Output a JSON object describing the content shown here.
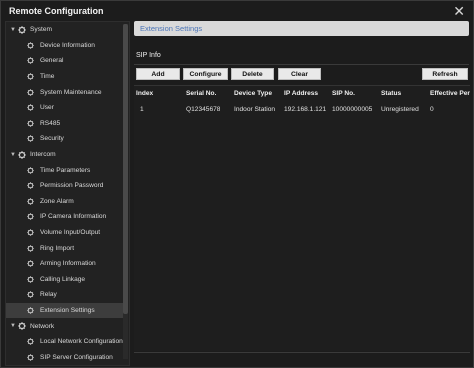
{
  "window": {
    "title": "Remote Configuration",
    "close_glyph": "✕"
  },
  "tree": {
    "groups": [
      {
        "label": "System",
        "items": [
          "Device Information",
          "General",
          "Time",
          "System Maintenance",
          "User",
          "RS485",
          "Security"
        ]
      },
      {
        "label": "Intercom",
        "items": [
          "Time Parameters",
          "Permission Password",
          "Zone Alarm",
          "IP Camera Information",
          "Volume Input/Output",
          "Ring Import",
          "Arming Information",
          "Calling Linkage",
          "Relay",
          "Extension Settings"
        ]
      },
      {
        "label": "Network",
        "items": [
          "Local Network Configuration",
          "SIP Server Configuration"
        ]
      }
    ],
    "selected": "Extension Settings"
  },
  "main": {
    "section_title": "Extension Settings",
    "subtitle": "SIP Info",
    "buttons": {
      "add": "Add",
      "configure": "Configure",
      "delete": "Delete",
      "clear": "Clear",
      "refresh": "Refresh"
    },
    "table": {
      "headers": [
        "Index",
        "Serial No.",
        "Device Type",
        "IP Address",
        "SIP No.",
        "Status",
        "Effective Per"
      ],
      "rows": [
        [
          "1",
          "Q12345678",
          "Indoor Station",
          "192.168.1.121",
          "10000000005",
          "Unregistered",
          "0"
        ]
      ]
    }
  },
  "colors": {
    "accent": "#4d76b8",
    "panel": "#222222",
    "background": "#1c1c1c"
  },
  "icons": {
    "group": "gear-icon",
    "leaf": "gear-icon",
    "expand": "caret-down-icon",
    "close": "close-icon"
  }
}
